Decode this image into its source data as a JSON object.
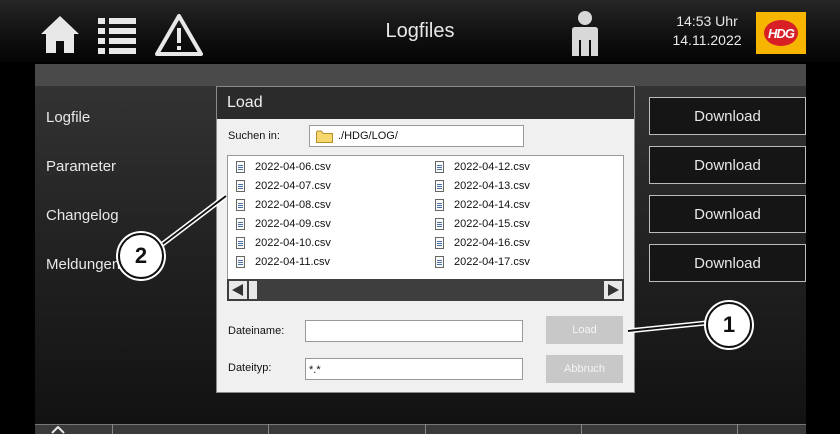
{
  "header": {
    "title": "Logfiles",
    "time": "14:53 Uhr",
    "date": "14.11.2022",
    "logo_text": "HDG",
    "icons": [
      "home-icon",
      "list-icon",
      "warning-icon",
      "user-icon"
    ]
  },
  "sidebar": {
    "items": [
      {
        "label": "Logfile"
      },
      {
        "label": "Parameter"
      },
      {
        "label": "Changelog"
      },
      {
        "label": "Meldungen"
      }
    ]
  },
  "downloads": [
    {
      "label": "Download"
    },
    {
      "label": "Download"
    },
    {
      "label": "Download"
    },
    {
      "label": "Download"
    }
  ],
  "dialog": {
    "title": "Load",
    "search_label": "Suchen in:",
    "path": "./HDG/LOG/",
    "files_col1": [
      "2022-04-06.csv",
      "2022-04-07.csv",
      "2022-04-08.csv",
      "2022-04-09.csv",
      "2022-04-10.csv",
      "2022-04-11.csv"
    ],
    "files_col2": [
      "2022-04-12.csv",
      "2022-04-13.csv",
      "2022-04-14.csv",
      "2022-04-15.csv",
      "2022-04-16.csv",
      "2022-04-17.csv"
    ],
    "filename_label": "Dateiname:",
    "filename_value": "",
    "filetype_label": "Dateityp:",
    "filetype_value": "*.*",
    "load_label": "Load",
    "cancel_label": "Abbruch"
  },
  "callouts": [
    "1",
    "2"
  ],
  "colors": {
    "logo_bg": "#f7b500",
    "logo_red": "#d91f26",
    "dialog_bg": "#f0f0f0"
  }
}
